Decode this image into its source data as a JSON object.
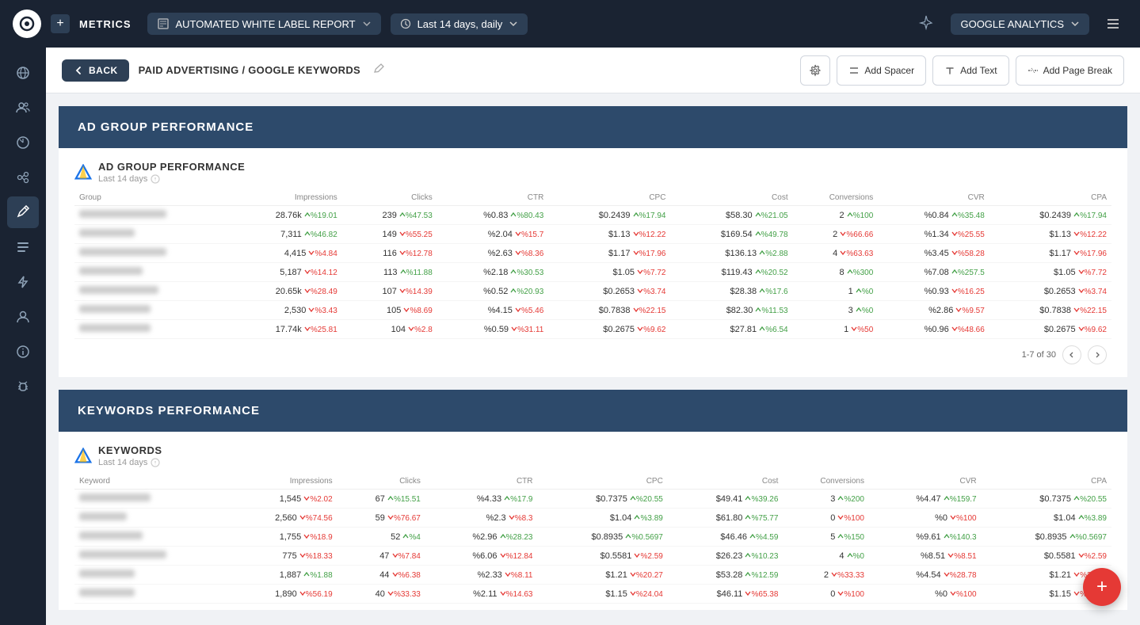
{
  "topNav": {
    "logoText": "○",
    "plusLabel": "+",
    "metricsLabel": "METRICS",
    "reportName": "AUTOMATED WHITE LABEL REPORT",
    "dateRange": "Last 14 days, daily",
    "analyticsLabel": "GOOGLE ANALYTICS"
  },
  "subheader": {
    "backLabel": "BACK",
    "breadcrumb": "PAID ADVERTISING / GOOGLE KEYWORDS",
    "addSpacerLabel": "Add Spacer",
    "addTextLabel": "Add Text",
    "addPageBreakLabel": "Add Page Break"
  },
  "adGroupSection": {
    "sectionTitle": "AD GROUP PERFORMANCE",
    "cardTitle": "AD GROUP PERFORMANCE",
    "lastDays": "Last 14 days",
    "columns": [
      "Group",
      "Impressions",
      "Clicks",
      "CTR",
      "CPC",
      "Cost",
      "Conversions",
      "CVR",
      "CPA"
    ],
    "rows": [
      {
        "group_w": 110,
        "impressions": "28.76k",
        "imp_dir": "up",
        "imp_pct": "%19.01",
        "clicks": "239",
        "clk_dir": "up",
        "clk_pct": "%47.53",
        "ctr": "%0.83",
        "ctr_dir": "up",
        "ctr_pct": "%80.43",
        "cpc": "$0.2439",
        "cpc_dir": "up",
        "cpc_pct": "%17.94",
        "cost": "$58.30",
        "cost_dir": "up",
        "cost_pct": "%21.05",
        "conv": "2",
        "conv_dir": "up",
        "conv_pct": "%100",
        "cvr": "%0.84",
        "cvr_dir": "up",
        "cvr_pct": "%35.48",
        "cpa": "$0.2439",
        "cpa_dir": "up",
        "cpa_pct": "%17.94"
      },
      {
        "group_w": 70,
        "impressions": "7,311",
        "imp_dir": "up",
        "imp_pct": "%46.82",
        "clicks": "149",
        "clk_dir": "down",
        "clk_pct": "%55.25",
        "ctr": "%2.04",
        "ctr_dir": "down",
        "ctr_pct": "%15.7",
        "cpc": "$1.13",
        "cpc_dir": "down",
        "cpc_pct": "%12.22",
        "cost": "$169.54",
        "cost_dir": "up",
        "cost_pct": "%49.78",
        "conv": "2",
        "conv_dir": "down",
        "conv_pct": "%66.66",
        "cvr": "%1.34",
        "cvr_dir": "down",
        "cvr_pct": "%25.55",
        "cpa": "$1.13",
        "cpa_dir": "down",
        "cpa_pct": "%12.22"
      },
      {
        "group_w": 110,
        "impressions": "4,415",
        "imp_dir": "down",
        "imp_pct": "%4.84",
        "clicks": "116",
        "clk_dir": "down",
        "clk_pct": "%12.78",
        "ctr": "%2.63",
        "ctr_dir": "down",
        "ctr_pct": "%8.36",
        "cpc": "$1.17",
        "cpc_dir": "down",
        "cpc_pct": "%17.96",
        "cost": "$136.13",
        "cost_dir": "up",
        "cost_pct": "%2.88",
        "conv": "4",
        "conv_dir": "down",
        "conv_pct": "%63.63",
        "cvr": "%3.45",
        "cvr_dir": "down",
        "cvr_pct": "%58.28",
        "cpa": "$1.17",
        "cpa_dir": "down",
        "cpa_pct": "%17.96"
      },
      {
        "group_w": 80,
        "impressions": "5,187",
        "imp_dir": "down",
        "imp_pct": "%14.12",
        "clicks": "113",
        "clk_dir": "up",
        "clk_pct": "%11.88",
        "ctr": "%2.18",
        "ctr_dir": "up",
        "ctr_pct": "%30.53",
        "cpc": "$1.05",
        "cpc_dir": "down",
        "cpc_pct": "%7.72",
        "cost": "$119.43",
        "cost_dir": "up",
        "cost_pct": "%20.52",
        "conv": "8",
        "conv_dir": "up",
        "conv_pct": "%300",
        "cvr": "%7.08",
        "cvr_dir": "up",
        "cvr_pct": "%257.5",
        "cpa": "$1.05",
        "cpa_dir": "down",
        "cpa_pct": "%7.72"
      },
      {
        "group_w": 100,
        "impressions": "20.65k",
        "imp_dir": "down",
        "imp_pct": "%28.49",
        "clicks": "107",
        "clk_dir": "down",
        "clk_pct": "%14.39",
        "ctr": "%0.52",
        "ctr_dir": "up",
        "ctr_pct": "%20.93",
        "cpc": "$0.2653",
        "cpc_dir": "down",
        "cpc_pct": "%3.74",
        "cost": "$28.38",
        "cost_dir": "up",
        "cost_pct": "%17.6",
        "conv": "1",
        "conv_dir": "up",
        "conv_pct": "%0",
        "cvr": "%0.93",
        "cvr_dir": "down",
        "cvr_pct": "%16.25",
        "cpa": "$0.2653",
        "cpa_dir": "down",
        "cpa_pct": "%3.74"
      },
      {
        "group_w": 90,
        "impressions": "2,530",
        "imp_dir": "down",
        "imp_pct": "%3.43",
        "clicks": "105",
        "clk_dir": "down",
        "clk_pct": "%8.69",
        "ctr": "%4.15",
        "ctr_dir": "down",
        "ctr_pct": "%5.46",
        "cpc": "$0.7838",
        "cpc_dir": "down",
        "cpc_pct": "%22.15",
        "cost": "$82.30",
        "cost_dir": "up",
        "cost_pct": "%11.53",
        "conv": "3",
        "conv_dir": "up",
        "conv_pct": "%0",
        "cvr": "%2.86",
        "cvr_dir": "down",
        "cvr_pct": "%9.57",
        "cpa": "$0.7838",
        "cpa_dir": "down",
        "cpa_pct": "%22.15"
      },
      {
        "group_w": 90,
        "impressions": "17.74k",
        "imp_dir": "down",
        "imp_pct": "%25.81",
        "clicks": "104",
        "clk_dir": "down",
        "clk_pct": "%2.8",
        "ctr": "%0.59",
        "ctr_dir": "down",
        "ctr_pct": "%31.11",
        "cpc": "$0.2675",
        "cpc_dir": "down",
        "cpc_pct": "%9.62",
        "cost": "$27.81",
        "cost_dir": "up",
        "cost_pct": "%6.54",
        "conv": "1",
        "conv_dir": "down",
        "conv_pct": "%50",
        "cvr": "%0.96",
        "cvr_dir": "down",
        "cvr_pct": "%48.66",
        "cpa": "$0.2675",
        "cpa_dir": "down",
        "cpa_pct": "%9.62"
      }
    ],
    "pagination": "1-7 of 30"
  },
  "keywordsSection": {
    "sectionTitle": "KEYWORDS PERFORMANCE",
    "cardTitle": "KEYWORDS",
    "lastDays": "Last 14 days",
    "columns": [
      "Keyword",
      "Impressions",
      "Clicks",
      "CTR",
      "CPC",
      "Cost",
      "Conversions",
      "CVR",
      "CPA"
    ],
    "rows": [
      {
        "kw_w": 90,
        "impressions": "1,545",
        "imp_dir": "down",
        "imp_pct": "%2.02",
        "clicks": "67",
        "clk_dir": "up",
        "clk_pct": "%15.51",
        "ctr": "%4.33",
        "ctr_dir": "up",
        "ctr_pct": "%17.9",
        "cpc": "$0.7375",
        "cpc_dir": "up",
        "cpc_pct": "%20.55",
        "cost": "$49.41",
        "cost_dir": "up",
        "cost_pct": "%39.26",
        "conv": "3",
        "conv_dir": "up",
        "conv_pct": "%200",
        "cvr": "%4.47",
        "cvr_dir": "up",
        "cvr_pct": "%159.7",
        "cpa": "$0.7375",
        "cpa_dir": "up",
        "cpa_pct": "%20.55"
      },
      {
        "kw_w": 60,
        "impressions": "2,560",
        "imp_dir": "down",
        "imp_pct": "%74.56",
        "clicks": "59",
        "clk_dir": "down",
        "clk_pct": "%76.67",
        "ctr": "%2.3",
        "ctr_dir": "down",
        "ctr_pct": "%8.3",
        "cpc": "$1.04",
        "cpc_dir": "up",
        "cpc_pct": "%3.89",
        "cost": "$61.80",
        "cost_dir": "up",
        "cost_pct": "%75.77",
        "conv": "0",
        "conv_dir": "down",
        "conv_pct": "%100",
        "cvr": "%0",
        "cvr_dir": "down",
        "cvr_pct": "%100",
        "cpa": "$1.04",
        "cpa_dir": "up",
        "cpa_pct": "%3.89"
      },
      {
        "kw_w": 80,
        "impressions": "1,755",
        "imp_dir": "down",
        "imp_pct": "%18.9",
        "clicks": "52",
        "clk_dir": "up",
        "clk_pct": "%4",
        "ctr": "%2.96",
        "ctr_dir": "up",
        "ctr_pct": "%28.23",
        "cpc": "$0.8935",
        "cpc_dir": "up",
        "cpc_pct": "%0.5697",
        "cost": "$46.46",
        "cost_dir": "up",
        "cost_pct": "%4.59",
        "conv": "5",
        "conv_dir": "up",
        "conv_pct": "%150",
        "cvr": "%9.61",
        "cvr_dir": "up",
        "cvr_pct": "%140.3",
        "cpa": "$0.8935",
        "cpa_dir": "up",
        "cpa_pct": "%0.5697"
      },
      {
        "kw_w": 110,
        "impressions": "775",
        "imp_dir": "down",
        "imp_pct": "%18.33",
        "clicks": "47",
        "clk_dir": "down",
        "clk_pct": "%7.84",
        "ctr": "%6.06",
        "ctr_dir": "down",
        "ctr_pct": "%12.84",
        "cpc": "$0.5581",
        "cpc_dir": "down",
        "cpc_pct": "%2.59",
        "cost": "$26.23",
        "cost_dir": "up",
        "cost_pct": "%10.23",
        "conv": "4",
        "conv_dir": "up",
        "conv_pct": "%0",
        "cvr": "%8.51",
        "cvr_dir": "down",
        "cvr_pct": "%8.51",
        "cpa": "$0.5581",
        "cpa_dir": "down",
        "cpa_pct": "%2.59"
      },
      {
        "kw_w": 70,
        "impressions": "1,887",
        "imp_dir": "up",
        "imp_pct": "%1.88",
        "clicks": "44",
        "clk_dir": "down",
        "clk_pct": "%6.38",
        "ctr": "%2.33",
        "ctr_dir": "down",
        "ctr_pct": "%8.11",
        "cpc": "$1.21",
        "cpc_dir": "down",
        "cpc_pct": "%20.27",
        "cost": "$53.28",
        "cost_dir": "up",
        "cost_pct": "%12.59",
        "conv": "2",
        "conv_dir": "down",
        "conv_pct": "%33.33",
        "cvr": "%4.54",
        "cvr_dir": "down",
        "cvr_pct": "%28.78",
        "cpa": "$1.21",
        "cpa_dir": "down",
        "cpa_pct": "%20.27"
      },
      {
        "kw_w": 70,
        "impressions": "1,890",
        "imp_dir": "down",
        "imp_pct": "%56.19",
        "clicks": "40",
        "clk_dir": "down",
        "clk_pct": "%33.33",
        "ctr": "%2.11",
        "ctr_dir": "down",
        "ctr_pct": "%14.63",
        "cpc": "$1.15",
        "cpc_dir": "down",
        "cpc_pct": "%24.04",
        "cost": "$46.11",
        "cost_dir": "down",
        "cost_pct": "%65.38",
        "conv": "0",
        "conv_dir": "down",
        "conv_pct": "%100",
        "cvr": "%0",
        "cvr_dir": "down",
        "cvr_pct": "%100",
        "cpa": "$1.15",
        "cpa_dir": "down",
        "cpa_pct": "%24.04"
      }
    ]
  },
  "sidebar": {
    "items": [
      {
        "icon": "globe",
        "name": "globe-icon"
      },
      {
        "icon": "people",
        "name": "people-icon"
      },
      {
        "icon": "chart",
        "name": "chart-icon"
      },
      {
        "icon": "connect",
        "name": "connect-icon"
      },
      {
        "icon": "pencil",
        "name": "pencil-icon"
      },
      {
        "icon": "list",
        "name": "list-icon"
      },
      {
        "icon": "bolt",
        "name": "bolt-icon"
      },
      {
        "icon": "person",
        "name": "person-icon"
      },
      {
        "icon": "info",
        "name": "info-icon"
      },
      {
        "icon": "bug",
        "name": "bug-icon"
      }
    ]
  },
  "fab": {
    "label": "+"
  }
}
